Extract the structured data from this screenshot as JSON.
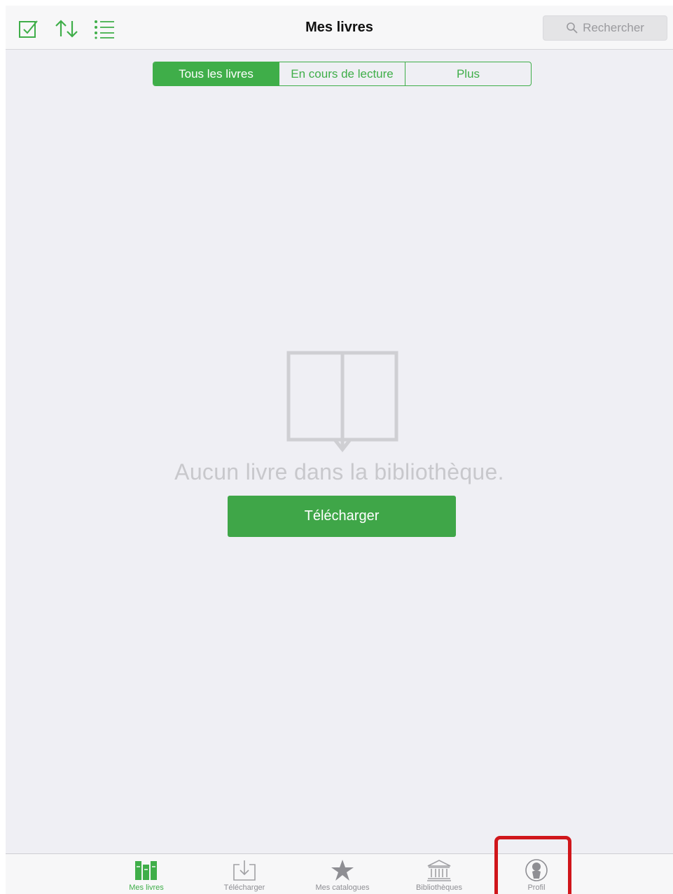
{
  "colors": {
    "accent": "#3fae49",
    "button": "#3fa648",
    "highlight": "#d0161b"
  },
  "navbar": {
    "title": "Mes livres",
    "icons": [
      "select-check-icon",
      "sort-arrows-icon",
      "list-view-icon"
    ],
    "search_placeholder": "Rechercher"
  },
  "segments": [
    "Tous les livres",
    "En cours de lecture",
    "Plus"
  ],
  "segments_active": "Tous les livres",
  "empty_state": {
    "icon": "open-book-icon",
    "message": "Aucun livre dans la bibliothèque.",
    "button": "Télécharger"
  },
  "tabs": [
    {
      "label": "Mes livres",
      "icon": "books-icon",
      "active": true
    },
    {
      "label": "Télécharger",
      "icon": "download-tray-icon",
      "active": false
    },
    {
      "label": "Mes catalogues",
      "icon": "star-icon",
      "active": false
    },
    {
      "label": "Bibliothèques",
      "icon": "library-building-icon",
      "active": false
    },
    {
      "label": "Profil",
      "icon": "profile-icon",
      "active": false,
      "highlighted": true
    }
  ]
}
